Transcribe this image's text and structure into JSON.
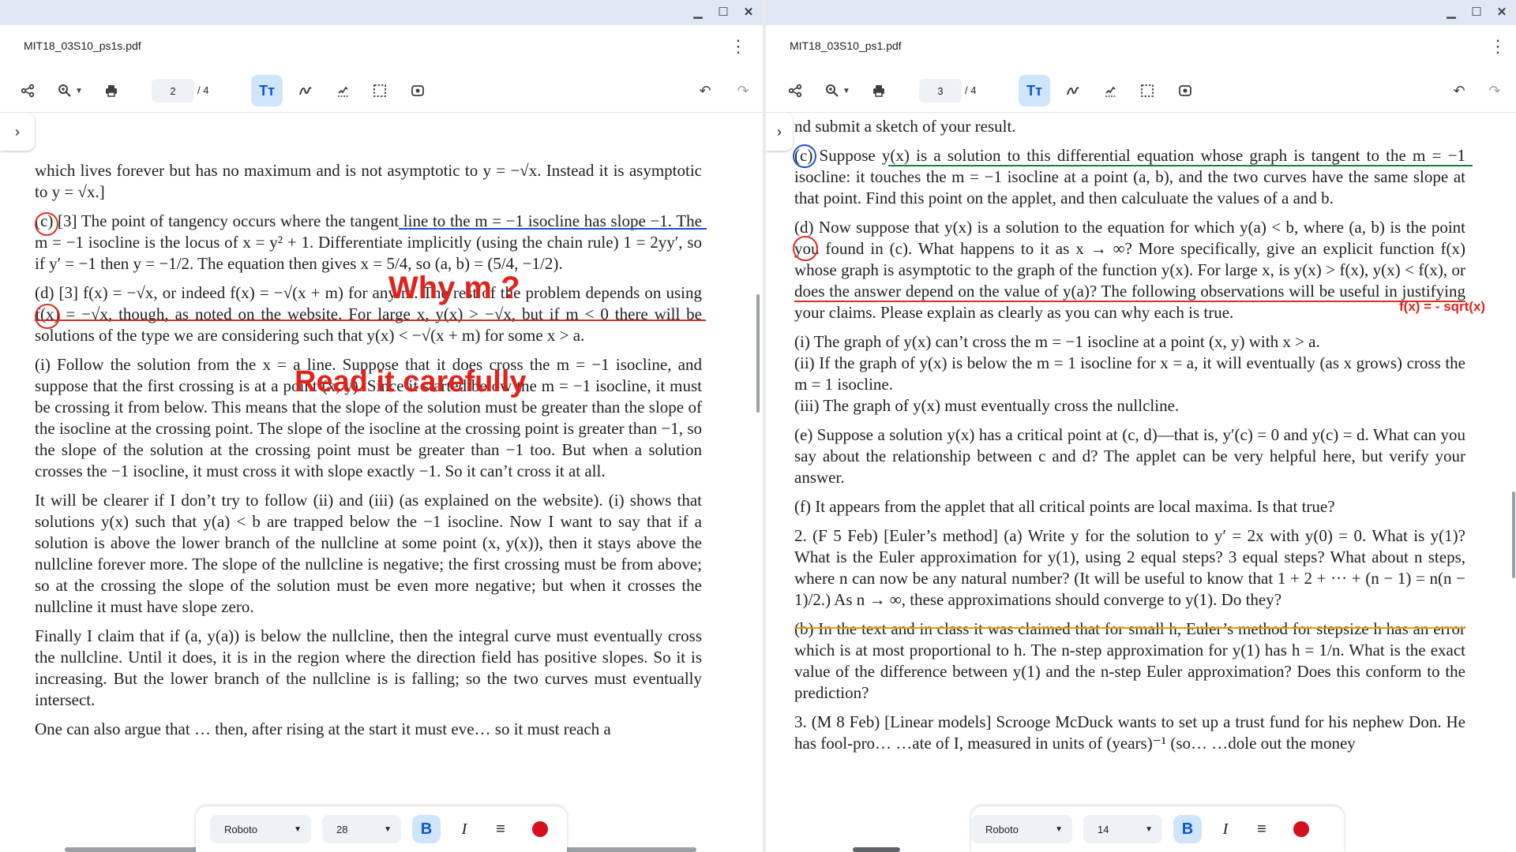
{
  "left": {
    "filename": "MIT18_03S10_ps1s.pdf",
    "page_current": "2",
    "page_total": "/ 4",
    "paragraphs": [
      "which lives forever but has no maximum and is not asymptotic to y = −√x. Instead it is asymptotic to y = √x.]",
      "(c) [3] The point of tangency occurs where the tangent line to the m = −1 isocline has slope −1. The m = −1 isocline is the locus of x = y² + 1. Differentiate implicitly (using the chain rule) 1 = 2yy′, so if y′ = −1 then y = −1/2. The equation then gives x = 5/4, so (a, b) = (5/4, −1/2).",
      "(d) [3] f(x) = −√x, or indeed f(x) = −√(x + m) for any m. The rest of the problem depends on using f(x) = −√x, though, as noted on the website. For large x, y(x) > −√x, but if m < 0 there will be solutions of the type we are considering such that y(x) < −√(x + m) for some x > a.",
      "(i) Follow the solution from the x = a line. Suppose that it does cross the m = −1 isocline, and suppose that the first crossing is at a point (x, y). Since it started below the m = −1 isocline, it must be crossing it from below. This means that the slope of the solution must be greater than the slope of the isocline at the crossing point. The slope of the isocline at the crossing point is greater than −1, so the slope of the solution at the crossing point must be greater than −1 too. But when a solution crosses the −1 isocline, it must cross it with slope exactly −1. So it can’t cross it at all.",
      "It will be clearer if I don’t try to follow (ii) and (iii) (as explained on the website). (i) shows that solutions y(x) such that y(a) < b are trapped below the −1 isocline. Now I want to say that if a solution is above the lower branch of the nullcline at some point (x, y(x)), then it stays above the nullcline forever more. The slope of the nullcline is negative; the first crossing must be from above; so at the crossing the slope of the solution must be even more negative; but when it crosses the nullcline it must have slope zero.",
      "Finally I claim that if (a, y(a)) is below the nullcline, then the integral curve must eventually cross the nullcline. Until it does, it is in the region where the direction field has positive slopes. So it is increasing. But the lower branch of the nullcline is is falling; so the two curves must eventually intersect.",
      "One can also argue that … then, after rising at the start it must eve… so it must reach a"
    ],
    "annotations": {
      "why_m": "Why m ?",
      "read_carefully": "Read it carefully"
    },
    "format_toolbar": {
      "font": "Roboto",
      "size": "28"
    }
  },
  "right": {
    "filename": "MIT18_03S10_ps1.pdf",
    "page_current": "3",
    "page_total": "/ 4",
    "paragraphs": [
      "nd submit a sketch of your result.",
      "(c) Suppose y(x) is a solution to this differential equation whose graph is tangent to the m = −1 isocline: it touches the m = −1 isocline at a point (a, b), and the two curves have the same slope at that point. Find this point on the applet, and then calculuate the values of a and b.",
      "(d) Now suppose that y(x) is a solution to the equation for which y(a) < b, where (a, b) is the point you found in (c). What happens to it as x → ∞? More specifically, give an explicit function f(x) whose graph is asymptotic to the graph of the function y(x). For large x, is y(x) > f(x), y(x) < f(x), or does the answer depend on the value of y(a)? The following observations will be useful in justifying your claims. Please explain as clearly as you can why each is true.",
      "(i) The graph of y(x) can’t cross the m = −1 isocline at a point (x, y) with x > a.",
      "(ii) If the graph of y(x) is below the m = 1 isocline for x = a, it will eventually (as x grows) cross the m = 1 isocline.",
      "(iii) The graph of y(x) must eventually cross the nullcline.",
      "(e) Suppose a solution y(x) has a critical point at (c, d)—that is, y′(c) = 0 and y(c) = d. What can you say about the relationship between c and d? The applet can be very helpful here, but verify your answer.",
      "(f) It appears from the applet that all critical points are local maxima. Is that true?",
      "2. (F 5 Feb) [Euler’s method] (a) Write y for the solution to y′ = 2x with y(0) = 0. What is y(1)? What is the Euler approximation for y(1), using 2 equal steps? 3 equal steps? What about n steps, where n can now be any natural number? (It will be useful to know that 1 + 2 + ··· + (n − 1) = n(n − 1)/2.) As n → ∞, these approximations should converge to y(1). Do they?",
      "(b) In the text and in class it was claimed that for small h, Euler’s method for stepsize h has an error which is at most proportional to h. The n-step approximation for y(1) has h = 1/n. What is the exact value of the difference between y(1) and the n-step Euler approximation? Does this conform to the prediction?",
      "3. (M 8 Feb) [Linear models] Scrooge McDuck wants to set up a trust fund for his nephew Don. He has fool-pro… …ate of I, measured in units of (years)⁻¹ (so… …dole out the money"
    ],
    "annotations": {
      "fx_note": "f(x) = - sqrt(x)"
    },
    "format_toolbar": {
      "font": "Roboto",
      "size": "14"
    }
  },
  "icons": [
    "share-icon",
    "zoom-icon",
    "print-icon",
    "text-tool-icon",
    "draw-icon",
    "signature-icon",
    "select-icon",
    "screenshot-icon",
    "undo-icon",
    "redo-icon",
    "menu-icon"
  ]
}
